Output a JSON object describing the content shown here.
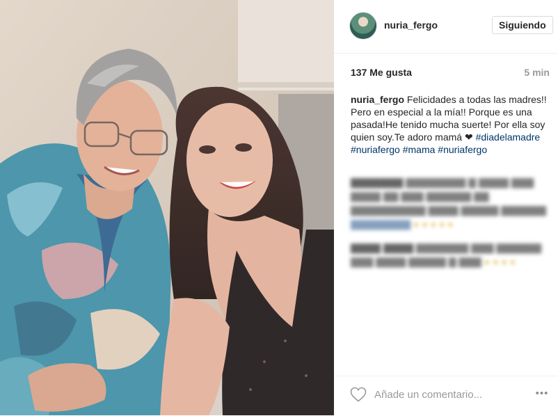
{
  "post": {
    "username": "nuria_fergo",
    "follow_label": "Siguiendo",
    "likes": "137 Me gusta",
    "time": "5 min"
  },
  "caption": {
    "user": "nuria_fergo",
    "text": " Felicidades a todas las madres!! Pero en especial a la mía!! Porque es una pasada!He tenido mucha suerte! Por ella soy quien soy.Te adoro mamá ❤ ",
    "tags": [
      "#diadelamadre",
      "#nuriafergo",
      "#mama",
      "#nuriafergo"
    ]
  },
  "footer": {
    "comment_placeholder": "Añade un comentario...",
    "more_label": "•••"
  },
  "icons": {
    "heart": "heart-icon",
    "more": "more-options-icon",
    "avatar": "avatar"
  },
  "colors": {
    "hashtag": "#003569",
    "muted": "#999999",
    "border": "#efefef"
  }
}
